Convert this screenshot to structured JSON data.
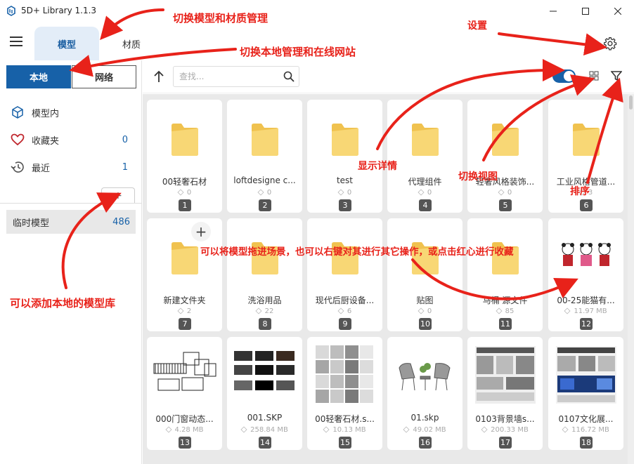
{
  "window": {
    "title": "5D+ Library 1.1.3"
  },
  "header": {
    "tabs": [
      {
        "label": "模型",
        "active": true
      },
      {
        "label": "材质",
        "active": false
      }
    ]
  },
  "sidebar": {
    "source_buttons": [
      {
        "label": "本地",
        "active": true
      },
      {
        "label": "网络",
        "active": false
      }
    ],
    "items": [
      {
        "label": "模型内",
        "icon": "cube-icon",
        "count": ""
      },
      {
        "label": "收藏夹",
        "icon": "heart-icon",
        "count": "0"
      },
      {
        "label": "最近",
        "icon": "history-icon",
        "count": "1"
      }
    ],
    "add_label": "+",
    "temp": {
      "label": "临时模型",
      "count": "486"
    }
  },
  "toolbar": {
    "search_placeholder": "查找..."
  },
  "grid": {
    "cards": [
      {
        "name": "00轻奢石材",
        "meta": "0",
        "index": "1",
        "thumb": "folder"
      },
      {
        "name": "loftdesigne c...",
        "meta": "0",
        "index": "2",
        "thumb": "folder"
      },
      {
        "name": "test",
        "meta": "0",
        "index": "3",
        "thumb": "folder"
      },
      {
        "name": "代理组件",
        "meta": "0",
        "index": "4",
        "thumb": "folder"
      },
      {
        "name": "轻奢风格装饰...",
        "meta": "0",
        "index": "5",
        "thumb": "folder"
      },
      {
        "name": "工业风格管道...",
        "meta": "3",
        "index": "6",
        "thumb": "folder"
      },
      {
        "name": "新建文件夹",
        "meta": "2",
        "index": "7",
        "thumb": "folder"
      },
      {
        "name": "洗浴用品",
        "meta": "22",
        "index": "8",
        "thumb": "folder"
      },
      {
        "name": "现代后厨设备...",
        "meta": "6",
        "index": "9",
        "thumb": "folder"
      },
      {
        "name": "贴图",
        "meta": "0",
        "index": "10",
        "thumb": "folder"
      },
      {
        "name": "马桶 源文件",
        "meta": "85",
        "index": "11",
        "thumb": "folder"
      },
      {
        "name": "00-25能猫有...",
        "meta": "11.97 MB",
        "index": "12",
        "thumb": "pandas"
      },
      {
        "name": "000门窗动态...",
        "meta": "4.28 MB",
        "index": "13",
        "thumb": "doors"
      },
      {
        "name": "001.SKP",
        "meta": "258.84 MB",
        "index": "14",
        "thumb": "dark-panels"
      },
      {
        "name": "00轻奢石材.s...",
        "meta": "10.13 MB",
        "index": "15",
        "thumb": "stone"
      },
      {
        "name": "01.skp",
        "meta": "49.02 MB",
        "index": "16",
        "thumb": "chairs"
      },
      {
        "name": "0103背景墙s...",
        "meta": "200.33 MB",
        "index": "17",
        "thumb": "wall-sheets"
      },
      {
        "name": "0107文化展...",
        "meta": "116.72 MB",
        "index": "18",
        "thumb": "exhibit"
      }
    ]
  },
  "annotations": {
    "switch_tabs": "切换模型和材质管理",
    "settings": "设置",
    "switch_source": "切换本地管理和在线网站",
    "show_details": "显示详情",
    "switch_view": "切换视图",
    "sort": "排序",
    "drag_hint": "可以将模型拖进场景，也可以右键对其进行其它操作，或点击红心进行收藏",
    "add_library": "可以添加本地的模型库"
  },
  "colors": {
    "accent": "#1761a8",
    "annotation": "#e8221a",
    "folder": "#f8d775"
  }
}
